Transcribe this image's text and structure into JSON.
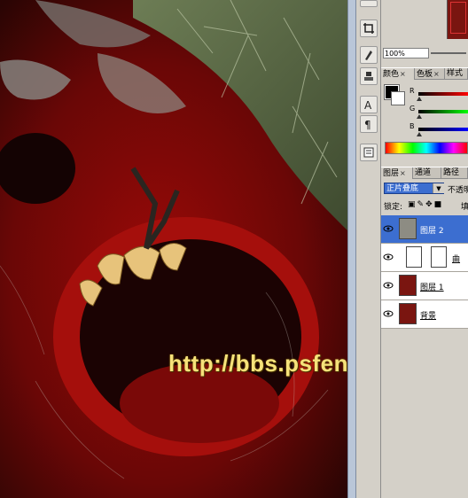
{
  "watermark": "http://bbs.psfeng.cn/",
  "navigator": {
    "zoom": "100%"
  },
  "color_panel": {
    "tabs": [
      {
        "label": "颜色",
        "close": "×"
      },
      {
        "label": "色板",
        "close": "×"
      },
      {
        "label": "样式",
        "close": ""
      }
    ],
    "channels": [
      "R",
      "G",
      "B"
    ],
    "foreground": "#000000",
    "background": "#ffffff"
  },
  "layers_panel": {
    "tabs": [
      {
        "label": "图层",
        "close": "×"
      },
      {
        "label": "通道",
        "close": ""
      },
      {
        "label": "路径",
        "close": ""
      }
    ],
    "blend_mode": "正片叠底",
    "opacity_label": "不透明",
    "lock_label": "锁定:",
    "lock_extra": "填",
    "layers": [
      {
        "name": "图层 2",
        "selected": true
      },
      {
        "name": "曲",
        "adjustment": true
      },
      {
        "name": "图层 1"
      },
      {
        "name": "背景"
      }
    ]
  },
  "colors": {
    "accent": "#3c6ed0",
    "panel": "#d4d0c8"
  }
}
